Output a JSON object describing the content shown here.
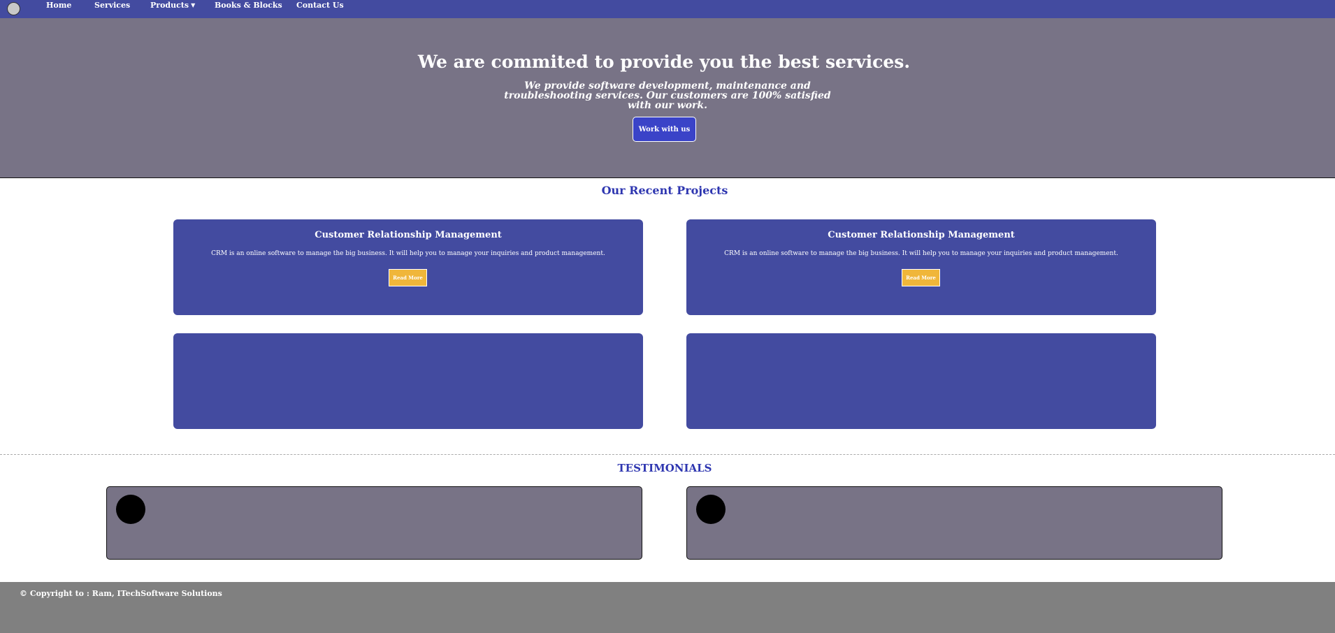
{
  "nav": {
    "items": [
      "Home",
      "Services",
      "Products",
      "Books & Blocks",
      "Contact Us"
    ]
  },
  "hero": {
    "title": "We are commited to provide you the best services.",
    "subtitle": "We provide software development, maintenance and troubleshooting services. Our customers are 100% satisfied with our work.",
    "button_label": "Work with us"
  },
  "projects": {
    "heading": "Our Recent Projects",
    "cards": [
      {
        "title": "Customer Relationship Management",
        "text": "CRM is an online software to manage the big business. It will help you to manage your inquiries and product management.",
        "button_label": "Read More"
      },
      {
        "title": "Customer Relationship Management",
        "text": "CRM is an online software to manage the big business. It will help you to manage your inquiries and product management.",
        "button_label": "Read More"
      }
    ]
  },
  "testimonials": {
    "heading": "TESTIMONIALS"
  },
  "footer": {
    "text": "© Copyright to : Ram, ITechSoftware Solutions"
  },
  "colors": {
    "nav_bg": "#434ba0",
    "hero_bg": "#787386",
    "accent_button": "#3a43c8",
    "card_bg": "#434ba0",
    "read_more": "#f0b63a",
    "heading": "#2e36b0",
    "footer_bg": "#808080"
  }
}
